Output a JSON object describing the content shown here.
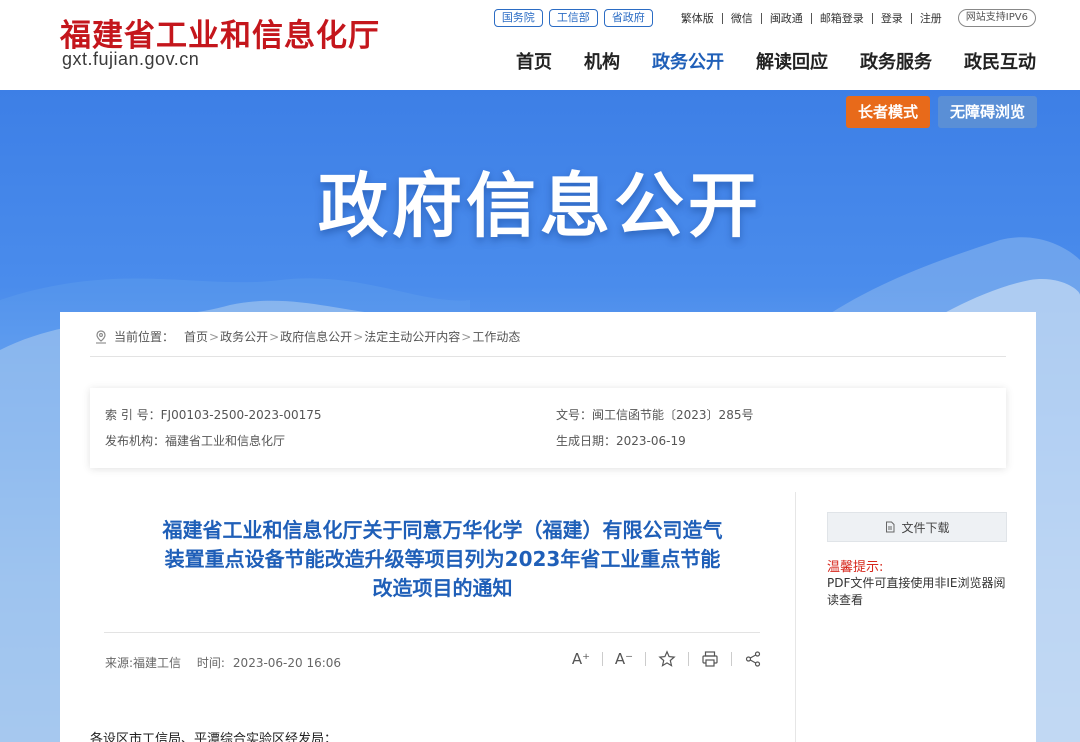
{
  "header": {
    "site_name": "福建省工业和信息化厅",
    "site_url": "gxt.fujian.gov.cn",
    "pills": [
      "国务院",
      "工信部",
      "省政府"
    ],
    "utility_links": [
      "繁体版",
      "微信",
      "闽政通",
      "邮箱登录",
      "登录",
      "注册"
    ],
    "ipv6": "网站支持IPV6",
    "nav": [
      "首页",
      "机构",
      "政务公开",
      "解读回应",
      "政务服务",
      "政民互动"
    ],
    "nav_active": "政务公开"
  },
  "banner": {
    "title": "政府信息公开",
    "elder_mode": "长者模式",
    "accessible": "无障碍浏览"
  },
  "breadcrumb": {
    "label": "当前位置：",
    "items": [
      "首页",
      "政务公开",
      "政府信息公开",
      "法定主动公开内容",
      "工作动态"
    ],
    "separator": ">"
  },
  "meta": {
    "index_label": "索 引 号：",
    "index_value": "FJ00103-2500-2023-00175",
    "org_label": "发布机构：",
    "org_value": "福建省工业和信息化厅",
    "docno_label": "文号：",
    "docno_value": "闽工信函节能〔2023〕285号",
    "date_label": "生成日期：",
    "date_value": "2023-06-19"
  },
  "article": {
    "title_line1": "福建省工业和信息化厅关于同意万华化学（福建）有限公司造气",
    "title_line2": "装置重点设备节能改造升级等项目列为2023年省工业重点节能",
    "title_line3": "改造项目的通知",
    "source": "来源:福建工信",
    "time_label": "时间:",
    "time_value": "2023-06-20 16:06",
    "salutation": "各设区市工信局、平潭综合实验区经发局："
  },
  "toolbar": {
    "font_up": "A⁺",
    "font_down": "A⁻"
  },
  "sidebar": {
    "download": "文件下载",
    "tip_title": "温馨提示:",
    "tip_text": "PDF文件可直接使用非IE浏览器阅读查看"
  },
  "colors": {
    "brand_red": "#c4161c",
    "nav_active": "#1f5fb8",
    "elder_orange": "#e86a1a"
  }
}
